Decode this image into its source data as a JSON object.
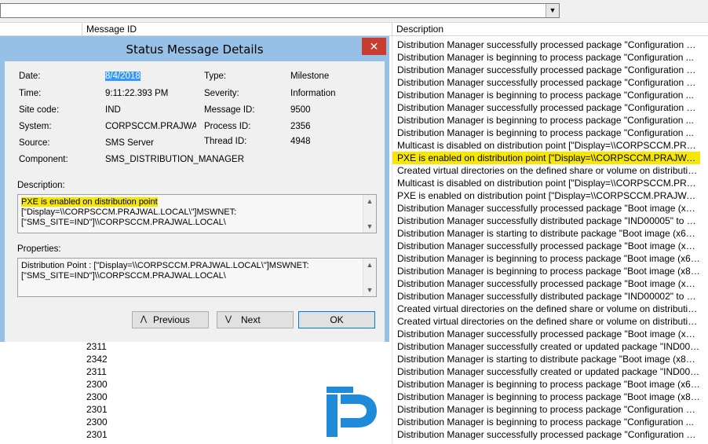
{
  "list": {
    "columns": {
      "message_id": "Message ID",
      "description": "Description"
    },
    "description_rows": [
      "Distribution Manager successfully processed package \"Configuration M...",
      "Distribution Manager is beginning to process package \"Configuration ...",
      "Distribution Manager successfully processed package \"Configuration M...",
      "Distribution Manager successfully processed package \"Configuration M...",
      "Distribution Manager is beginning to process package \"Configuration ...",
      "Distribution Manager successfully processed package \"Configuration M...",
      "Distribution Manager is beginning to process package \"Configuration ...",
      "Distribution Manager is beginning to process package \"Configuration ...",
      "Multicast is disabled on distribution point [\"Display=\\\\CORPSCCM.PRA...",
      "PXE is enabled on distribution point [\"Display=\\\\CORPSCCM.PRAJWAL....",
      "Created virtual directories on the defined share or volume on distributio...",
      "Multicast is disabled on distribution point [\"Display=\\\\CORPSCCM.PRA...",
      "PXE is enabled on distribution point [\"Display=\\\\CORPSCCM.PRAJWAL...",
      "Distribution Manager successfully processed package \"Boot image (x64...",
      "Distribution Manager successfully distributed package \"IND00005\" to di...",
      "Distribution Manager is starting to distribute package \"Boot image (x64)...",
      "Distribution Manager successfully processed package \"Boot image (x86...",
      "Distribution Manager is beginning to process package \"Boot image (x64...",
      "Distribution Manager is beginning to process package \"Boot image (x86...",
      "Distribution Manager successfully processed package \"Boot image (x86...",
      "Distribution Manager successfully distributed package \"IND00002\" to di...",
      "Created virtual directories on the defined share or volume on distributio...",
      "Created virtual directories on the defined share or volume on distributio...",
      "Distribution Manager successfully processed package \"Boot image (x64...",
      "Distribution Manager successfully created or updated package \"IND000...",
      "Distribution Manager is starting to distribute package \"Boot image (x86)...",
      "Distribution Manager successfully created or updated package \"IND000...",
      "Distribution Manager is beginning to process package \"Boot image (x64...",
      "Distribution Manager is beginning to process package \"Boot image (x86...",
      "Distribution Manager is beginning to process package \"Configuration M...",
      "Distribution Manager is beginning to process package \"Configuration ...",
      "Distribution Manager successfully processed package \"Configuration M..."
    ],
    "highlight_index": 9,
    "message_id_rows": [
      "2311",
      "2342",
      "2311",
      "2300",
      "2300",
      "2301",
      "2300",
      "2301"
    ]
  },
  "dialog": {
    "title": "Status Message Details",
    "close": "✕",
    "labels": {
      "date": "Date:",
      "time": "Time:",
      "site_code": "Site code:",
      "system": "System:",
      "source": "Source:",
      "component": "Component:",
      "type": "Type:",
      "severity": "Severity:",
      "message_id": "Message ID:",
      "process_id": "Process ID:",
      "thread_id": "Thread ID:",
      "description": "Description:",
      "properties": "Properties:"
    },
    "values": {
      "date": "8/4/2018",
      "time": "9:11:22.393 PM",
      "site_code": "IND",
      "system": "CORPSCCM.PRAJWAL.L",
      "source": "SMS Server",
      "component": "SMS_DISTRIBUTION_MANAGER",
      "type": "Milestone",
      "severity": "Information",
      "message_id": "9500",
      "process_id": "2356",
      "thread_id": "4948"
    },
    "description": {
      "highlight": "PXE is enabled on distribution point",
      "rest": " [\"Display=\\\\CORPSCCM.PRAJWAL.LOCAL\\\"]MSWNET:[\"SMS_SITE=IND\"]\\\\CORPSCCM.PRAJWAL.LOCAL\\"
    },
    "properties": "Distribution Point : [\"Display=\\\\CORPSCCM.PRAJWAL.LOCAL\\\"]MSWNET:[\"SMS_SITE=IND\"]\\\\CORPSCCM.PRAJWAL.LOCAL\\",
    "buttons": {
      "previous": "Previous",
      "next": "Next",
      "ok": "OK"
    },
    "icons": {
      "previous": "chevron-up-icon",
      "next": "chevron-down-icon"
    }
  }
}
